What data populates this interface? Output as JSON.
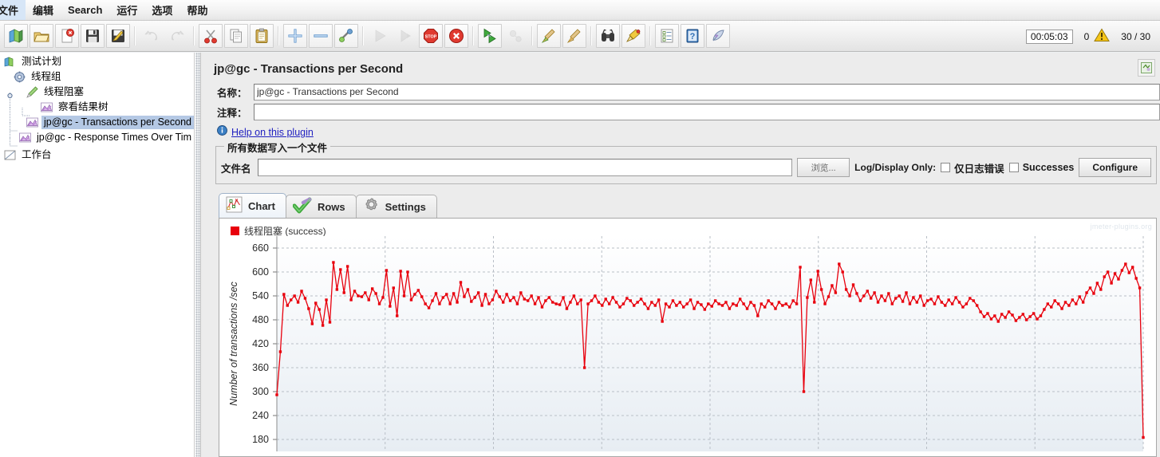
{
  "menu": {
    "items": [
      {
        "label": "文件",
        "clipped": true
      },
      {
        "label": "编辑"
      },
      {
        "label": "Search"
      },
      {
        "label": "运行"
      },
      {
        "label": "选项"
      },
      {
        "label": "帮助"
      }
    ]
  },
  "toolbar": {
    "buttons": [
      {
        "name": "new-test-plan",
        "icon": "new-icon"
      },
      {
        "name": "open-test-plan",
        "icon": "folder-open-icon"
      },
      {
        "name": "close-test-plan",
        "icon": "close-document-icon"
      },
      {
        "name": "save-test-plan",
        "icon": "floppy-save-icon"
      },
      {
        "name": "save-as-test-plan",
        "icon": "save-as-pencil-icon"
      },
      {
        "name": "undo",
        "icon": "undo-arrow-icon",
        "disabled": true
      },
      {
        "name": "redo",
        "icon": "redo-arrow-icon",
        "disabled": true
      },
      {
        "name": "cut",
        "icon": "scissors-icon"
      },
      {
        "name": "copy",
        "icon": "copy-pages-icon"
      },
      {
        "name": "paste",
        "icon": "clipboard-paste-icon"
      },
      {
        "name": "expand-all",
        "icon": "plus-icon"
      },
      {
        "name": "collapse-all",
        "icon": "minus-icon"
      },
      {
        "name": "toggle",
        "icon": "toggle-switch-icon"
      },
      {
        "name": "start",
        "icon": "play-icon",
        "disabled": true
      },
      {
        "name": "start-no-pauses",
        "icon": "play-no-pause-icon",
        "disabled": true
      },
      {
        "name": "stop",
        "icon": "stop-sign-icon"
      },
      {
        "name": "shutdown",
        "icon": "shutdown-circle-icon"
      },
      {
        "name": "remote-start-all",
        "icon": "remote-start-icon"
      },
      {
        "name": "remote-stop-all",
        "icon": "remote-stop-icon",
        "disabled": true
      },
      {
        "name": "clear",
        "icon": "broom-clear-icon"
      },
      {
        "name": "clear-all",
        "icon": "broom-clear-all-icon"
      },
      {
        "name": "search",
        "icon": "binoculars-icon"
      },
      {
        "name": "search-reset",
        "icon": "brush-reset-icon"
      },
      {
        "name": "function-helper",
        "icon": "checklist-icon"
      },
      {
        "name": "help",
        "icon": "help-book-icon"
      },
      {
        "name": "templates",
        "icon": "feather-templates-icon"
      }
    ],
    "status": {
      "elapsed_time": "00:05:03",
      "warning_count": "0",
      "warning_icon": "warning-triangle-icon",
      "threads": "30 / 30"
    }
  },
  "tree": {
    "nodes": [
      {
        "label": "测试计划",
        "depth": 0,
        "icon": "test-plan-icon",
        "selected": false
      },
      {
        "label": "线程组",
        "depth": 1,
        "icon": "thread-group-icon",
        "selected": false
      },
      {
        "label": "线程阻塞",
        "depth": 2,
        "icon": "test-action-icon",
        "selected": false
      },
      {
        "label": "察看结果树",
        "depth": 3,
        "icon": "view-results-tree-icon",
        "selected": false
      },
      {
        "label": "jp@gc - Transactions per Second",
        "depth": 2,
        "icon": "listener-chart-icon",
        "selected": true
      },
      {
        "label": "jp@gc - Response Times Over Tim",
        "depth": 2,
        "icon": "listener-chart-icon",
        "selected": false
      },
      {
        "label": "工作台",
        "depth": 0,
        "icon": "workbench-icon",
        "selected": false
      }
    ]
  },
  "panel": {
    "title": "jp@gc - Transactions per Second",
    "corner_icon": "maximize-panel-icon",
    "name_label": "名称：",
    "name_value": "jp@gc - Transactions per Second",
    "comment_label": "注释：",
    "comment_value": "",
    "help_icon": "info-icon",
    "help_link": "Help on this plugin",
    "file_group_title": "所有数据写入一个文件",
    "file_label": "文件名",
    "file_value": "",
    "file_placeholder": "",
    "browse_label": "浏览...",
    "log_display_label": "Log/Display Only:",
    "errors_only_label": "仅日志错误",
    "errors_only_checked": false,
    "successes_label": "Successes",
    "successes_checked": false,
    "configure_label": "Configure"
  },
  "tabs": [
    {
      "label": "Chart",
      "icon": "chart-scatter-icon",
      "active": true
    },
    {
      "label": "Rows",
      "icon": "green-check-icon",
      "active": false
    },
    {
      "label": "Settings",
      "icon": "gear-icon",
      "active": false
    }
  ],
  "chart_data": {
    "type": "line",
    "title": "",
    "xlabel": "",
    "ylabel": "Number of transactions /sec",
    "legend": [
      {
        "name": "线程阻塞 (success)",
        "color": "#e8000d"
      }
    ],
    "legend_position": "top-left",
    "grid": true,
    "watermark": "jmeter-plugins.org",
    "ylim": [
      150,
      690
    ],
    "yticks": [
      660,
      600,
      540,
      480,
      420,
      360,
      300,
      240,
      180
    ],
    "series": [
      {
        "name": "线程阻塞 (success)",
        "color": "#e8000d",
        "values": [
          292,
          400,
          544,
          516,
          530,
          540,
          524,
          552,
          534,
          508,
          470,
          522,
          506,
          466,
          530,
          474,
          624,
          556,
          606,
          548,
          614,
          530,
          552,
          540,
          538,
          548,
          530,
          558,
          546,
          520,
          536,
          604,
          514,
          560,
          490,
          602,
          540,
          600,
          530,
          544,
          554,
          538,
          520,
          510,
          528,
          546,
          520,
          536,
          544,
          520,
          546,
          524,
          574,
          538,
          556,
          526,
          536,
          548,
          516,
          544,
          520,
          530,
          552,
          538,
          524,
          544,
          528,
          536,
          520,
          548,
          532,
          528,
          540,
          520,
          536,
          512,
          528,
          536,
          524,
          520,
          518,
          536,
          508,
          524,
          540,
          520,
          530,
          360,
          520,
          528,
          540,
          524,
          516,
          532,
          520,
          536,
          524,
          512,
          520,
          534,
          528,
          516,
          524,
          532,
          520,
          508,
          524,
          516,
          530,
          476,
          520,
          512,
          528,
          516,
          524,
          512,
          520,
          530,
          508,
          524,
          518,
          506,
          520,
          514,
          528,
          520,
          516,
          524,
          508,
          520,
          516,
          532,
          520,
          508,
          524,
          516,
          490,
          520,
          512,
          528,
          520,
          508,
          524,
          516,
          520,
          512,
          528,
          520,
          612,
          300,
          536,
          580,
          524,
          602,
          556,
          520,
          538,
          566,
          548,
          620,
          600,
          556,
          540,
          568,
          546,
          528,
          540,
          552,
          534,
          548,
          524,
          540,
          528,
          546,
          520,
          534,
          540,
          526,
          548,
          520,
          536,
          524,
          540,
          516,
          528,
          532,
          520,
          538,
          524,
          516,
          530,
          520,
          536,
          524,
          512,
          520,
          534,
          528,
          516,
          500,
          488,
          496,
          482,
          490,
          476,
          494,
          486,
          500,
          492,
          478,
          486,
          494,
          480,
          488,
          496,
          482,
          490,
          506,
          520,
          512,
          528,
          520,
          508,
          524,
          516,
          530,
          520,
          538,
          524,
          548,
          560,
          546,
          572,
          556,
          588,
          600,
          572,
          596,
          582,
          604,
          620,
          598,
          612,
          584,
          560,
          185
        ]
      }
    ]
  }
}
